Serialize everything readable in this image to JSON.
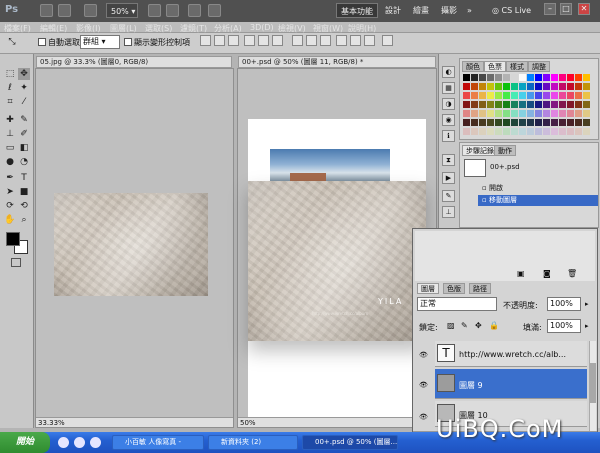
{
  "app": {
    "logo": "Ps",
    "zoom_select": "50%",
    "menus": [
      "檔案(F)",
      "編輯(E)",
      "影像(I)",
      "圖層(L)",
      "選取(S)",
      "濾鏡(T)",
      "分析(A)",
      "3D(D)",
      "檢視(V)",
      "視窗(W)",
      "說明(H)"
    ],
    "workspaces": [
      "基本功能",
      "設計",
      "繪畫",
      "攝影",
      "»"
    ],
    "cs_live": "CS Live"
  },
  "options_bar": {
    "auto_select_label": "自動選取:",
    "auto_select_value": "群組",
    "show_transform_label": "顯示變形控制項"
  },
  "documents": [
    {
      "tab": "05.jpg @ 33.3% (圖層0, RGB/8)",
      "status": "33.33%"
    },
    {
      "tab": "00+.psd @ 50% (圖層 11, RGB/8) *",
      "status": "50%"
    }
  ],
  "canvas_text": {
    "logo": "YILA",
    "url_line": "http://www.wretch.cc/album"
  },
  "swatches_panel": {
    "tabs": [
      "顏色",
      "色票",
      "樣式",
      "調整"
    ],
    "active": 1
  },
  "history_panel": {
    "tabs": [
      "步驟記錄",
      "動作"
    ],
    "snapshot": "00+.psd",
    "steps": [
      {
        "label": "開啟",
        "selected": false
      },
      {
        "label": "移動圖層",
        "selected": true
      }
    ]
  },
  "layers_panel": {
    "tabs": [
      "圖層",
      "色版",
      "路徑"
    ],
    "blend_mode": "正常",
    "opacity_label": "不透明度:",
    "opacity_value": "100%",
    "lock_label": "鎖定:",
    "fill_label": "填滿:",
    "fill_value": "100%",
    "layers": [
      {
        "name": "http://www.wretch.cc/alb...",
        "kind": "text",
        "thumb": "T",
        "selected": false
      },
      {
        "name": "圖層 9",
        "kind": "image",
        "thumb": "",
        "selected": true
      },
      {
        "name": "圖層 10",
        "kind": "image",
        "thumb": "",
        "selected": false
      }
    ]
  },
  "taskbar": {
    "start": "開始",
    "buttons": [
      {
        "label": "小百敏 人像寫真 -",
        "active": false
      },
      {
        "label": "新資料夾 (2)",
        "active": false
      },
      {
        "label": "00+.psd @ 50% (圖層...",
        "active": true
      }
    ]
  },
  "watermark": "UiBQ.CoM",
  "colors": {
    "app_bar": "#505050",
    "selection": "#3869c6",
    "taskbar": "#245fd0"
  }
}
